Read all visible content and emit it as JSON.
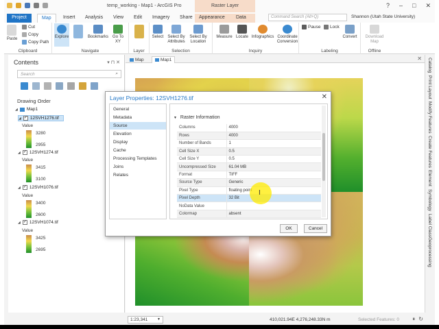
{
  "titlebar": {
    "title": "temp_working - Map1 - ArcGIS Pro",
    "context_tab_group": "Raster Layer",
    "window_buttons": [
      "?",
      "–",
      "□",
      "✕"
    ]
  },
  "ribbon_tabs": [
    "Project",
    "Map",
    "Insert",
    "Analysis",
    "View",
    "Edit",
    "Imagery",
    "Share",
    "Appearance",
    "Data"
  ],
  "search": {
    "placeholder": "Command Search (Alt+Q)"
  },
  "user": "Shannon (Utah State University)",
  "ribbon": {
    "clipboard": {
      "label": "Clipboard",
      "paste": "Paste",
      "cut": "Cut",
      "copy": "Copy",
      "copy_path": "Copy Path"
    },
    "navigate": {
      "label": "Navigate",
      "explore": "Explore",
      "bookmarks": "Bookmarks",
      "go_to_xy": "Go To XY"
    },
    "layer": {
      "label": "Layer"
    },
    "selection": {
      "label": "Selection",
      "select": "Select",
      "select_by_attributes": "Select By Attributes",
      "select_by_location": "Select By Location"
    },
    "inquiry": {
      "label": "Inquiry",
      "measure": "Measure",
      "locate": "Locate",
      "infographics": "Infographics",
      "coordinate_conversion": "Coordinate Conversion"
    },
    "labeling": {
      "label": "Labeling",
      "pause": "Pause",
      "lock": "Lock",
      "convert": "Convert"
    },
    "offline": {
      "label": "Offline",
      "download_map": "Download Map"
    }
  },
  "contents": {
    "title": "Contents",
    "search_placeholder": "Search",
    "drawing_order": "Drawing Order",
    "map_name": "Map1",
    "value_label": "Value",
    "layers": [
      {
        "name": "12SVH1276.tif",
        "high": "3280",
        "low": "2955"
      },
      {
        "name": "12SVH1274.tif",
        "high": "3415",
        "low": "3100"
      },
      {
        "name": "12SVH1076.tif",
        "high": "3400",
        "low": "2600"
      },
      {
        "name": "12SVH1074.tif",
        "high": "3425",
        "low": "2695"
      }
    ]
  },
  "map_tabs": [
    "Map",
    "Map1"
  ],
  "statusbar": {
    "scale": "1:23,341",
    "coordinates": "410,021.94E 4,276,248.33N m",
    "selected_features": "Selected Features: 0"
  },
  "right_tabs": [
    "Catalog",
    "Print Layout",
    "Modify Features",
    "Create Features",
    "Element",
    "Symbology",
    "Label Class",
    "Geoprocessing"
  ],
  "dialog": {
    "title": "Layer Properties: 12SVH1276.tif",
    "nav_items": [
      "General",
      "Metadata",
      "Source",
      "Elevation",
      "Display",
      "Cache",
      "Processing Templates",
      "Joins",
      "Relates"
    ],
    "active_nav": "Source",
    "section_title": "Raster Information",
    "properties": [
      {
        "key": "Columns",
        "value": "4000"
      },
      {
        "key": "Rows",
        "value": "4000"
      },
      {
        "key": "Number of Bands",
        "value": "1"
      },
      {
        "key": "Cell Size X",
        "value": "0.5"
      },
      {
        "key": "Cell Size Y",
        "value": "0.5"
      },
      {
        "key": "Uncompressed Size",
        "value": "61.04 MB"
      },
      {
        "key": "Format",
        "value": "TIFF"
      },
      {
        "key": "Source Type",
        "value": "Generic"
      },
      {
        "key": "Pixel Type",
        "value": "floating point"
      },
      {
        "key": "Pixel Depth",
        "value": "32 Bit"
      },
      {
        "key": "NoData Value",
        "value": ""
      },
      {
        "key": "Colormap",
        "value": "absent"
      }
    ],
    "ok_label": "OK",
    "cancel_label": "Cancel"
  },
  "colors": {
    "accent": "#1f74c6",
    "context_tab": "#f7dcc9",
    "selection": "#cde4f7",
    "cursor_highlight": "#ffeb00"
  }
}
